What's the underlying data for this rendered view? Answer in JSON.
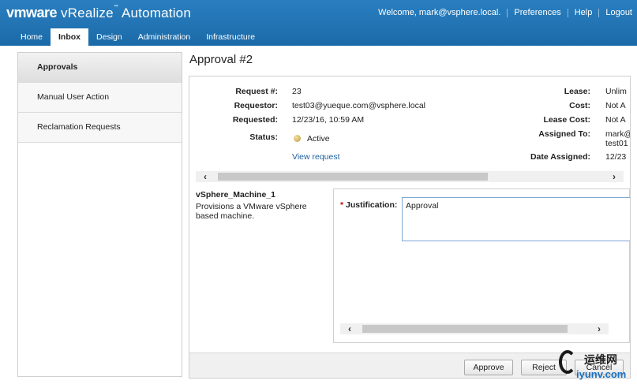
{
  "header": {
    "brand_vm": "vmware",
    "brand_product": "vRealize",
    "brand_tm": "™",
    "brand_suffix": "Automation",
    "welcome": "Welcome, mark@vsphere.local.",
    "preferences": "Preferences",
    "help": "Help",
    "logout": "Logout"
  },
  "tabs": [
    "Home",
    "Inbox",
    "Design",
    "Administration",
    "Infrastructure"
  ],
  "sidebar": {
    "items": [
      {
        "label": "Approvals"
      },
      {
        "label": "Manual User Action"
      },
      {
        "label": "Reclamation Requests"
      }
    ]
  },
  "page": {
    "title": "Approval #2"
  },
  "details": {
    "request_label": "Request #:",
    "request_value": "23",
    "requestor_label": "Requestor:",
    "requestor_value": "test03@yueque.com@vsphere.local",
    "requested_label": "Requested:",
    "requested_value": "12/23/16, 10:59 AM",
    "status_label": "Status:",
    "status_value": "Active",
    "view_request": "View request",
    "lease_label": "Lease:",
    "lease_value": "Unlim",
    "cost_label": "Cost:",
    "cost_value": "Not A",
    "lease_cost_label": "Lease Cost:",
    "lease_cost_value": "Not A",
    "assigned_to_label": "Assigned To:",
    "assigned_to_value_1": "mark@",
    "assigned_to_value_2": "test01",
    "date_assigned_label": "Date Assigned:",
    "date_assigned_value": "12/23"
  },
  "item": {
    "name": "vSphere_Machine_1",
    "description": "Provisions a VMware vSphere based machine."
  },
  "form": {
    "required_mark": "*",
    "justification_label": "Justification:",
    "justification_value": "Approval"
  },
  "buttons": {
    "approve": "Approve",
    "reject": "Reject",
    "cancel": "Cancel"
  },
  "scroll_arrows": {
    "left": "‹",
    "right": "›"
  },
  "watermark": {
    "line1": "运维网",
    "line2": "iyunv.com"
  },
  "colors": {
    "header_bg": "#1d6fb0",
    "link": "#1b5f9e",
    "required": "#cc0000"
  }
}
